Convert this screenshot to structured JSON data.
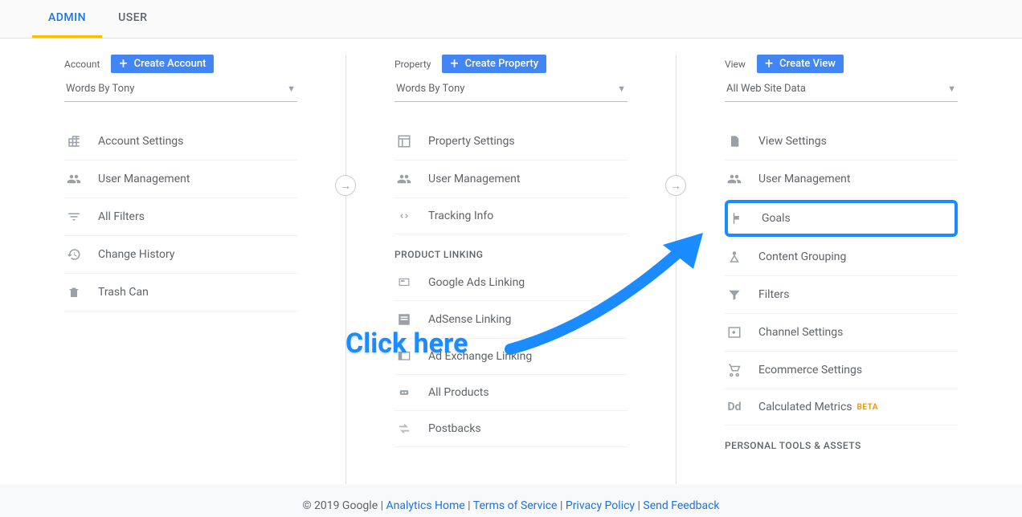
{
  "tabs": {
    "admin": "ADMIN",
    "user": "USER"
  },
  "acct": {
    "header": "Account",
    "create": "Create Account",
    "selected": "Words By Tony",
    "items": [
      "Account Settings",
      "User Management",
      "All Filters",
      "Change History",
      "Trash Can"
    ]
  },
  "prop": {
    "header": "Property",
    "create": "Create Property",
    "selected": "Words By Tony",
    "items_top": [
      "Property Settings",
      "User Management",
      "Tracking Info"
    ],
    "section1": "PRODUCT LINKING",
    "items_mid": [
      "Google Ads Linking",
      "AdSense Linking",
      "Ad Exchange Linking",
      "All Products",
      "Postbacks"
    ]
  },
  "view": {
    "header": "View",
    "create": "Create View",
    "selected": "All Web Site Data",
    "items": [
      "View Settings",
      "User Management",
      "Goals",
      "Content Grouping",
      "Filters",
      "Channel Settings",
      "Ecommerce Settings",
      "Calculated Metrics"
    ],
    "beta": "BETA",
    "section1": "PERSONAL TOOLS & ASSETS"
  },
  "callout": "Click here",
  "footer": {
    "copyright": "© 2019 Google",
    "home": "Analytics Home",
    "terms": "Terms of Service",
    "privacy": "Privacy Policy",
    "feedback": "Send Feedback"
  }
}
